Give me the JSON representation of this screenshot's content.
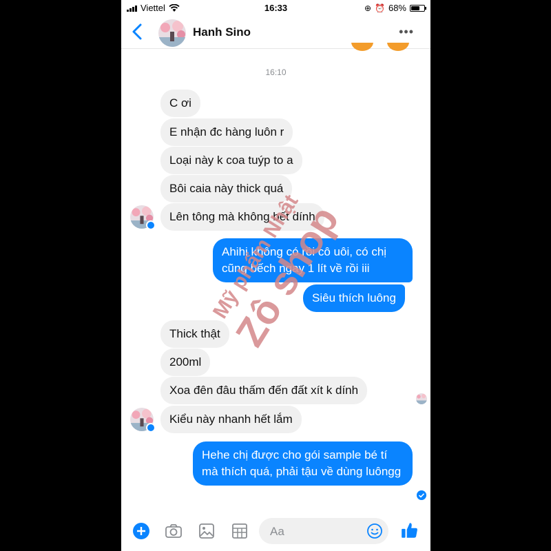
{
  "status_bar": {
    "carrier": "Viettel",
    "time": "16:33",
    "battery": "68%"
  },
  "header": {
    "contact_name": "Hanh Sino"
  },
  "timestamp": "16:10",
  "messages": [
    {
      "dir": "in",
      "text": "C ơi"
    },
    {
      "dir": "in",
      "text": "E nhận đc hàng luôn r"
    },
    {
      "dir": "in",
      "text": "Loại này k coa tuýp to a"
    },
    {
      "dir": "in",
      "text": "Bôi caia này thick quá"
    },
    {
      "dir": "in",
      "text": "Lên tông mà không bết dính"
    },
    {
      "dir": "out",
      "text": "Ahihi không có rồi cô uôi, có chị cũng bếch ngay 1 lít về rồi iii"
    },
    {
      "dir": "out",
      "text": "Siêu thích luông"
    },
    {
      "dir": "in",
      "text": "Thick thật"
    },
    {
      "dir": "in",
      "text": "200ml"
    },
    {
      "dir": "in",
      "text": "Xoa đên đâu thấm đến đất xít k dính"
    },
    {
      "dir": "in",
      "text": "Kiểu này nhanh hết lắm"
    },
    {
      "dir": "out",
      "text": "Hehe chị được cho gói sample bé tí mà thích quá, phải tậu về dùng luôngg"
    }
  ],
  "composer": {
    "placeholder": "Aa"
  },
  "watermark": {
    "line1": "Mỹ phẩm Nhật",
    "line2": "Zô shop"
  },
  "icons": {
    "back": "chevron-left-icon",
    "more": "more-dots-icon",
    "add": "plus-circle-icon",
    "camera": "camera-icon",
    "gallery": "image-icon",
    "sticker": "sticker-grid-icon",
    "emoji": "emoji-icon",
    "like": "thumbs-up-icon"
  },
  "colors": {
    "accent": "#0a84ff",
    "incoming_bubble": "#f0f0f0",
    "watermark": "#d4878a"
  }
}
